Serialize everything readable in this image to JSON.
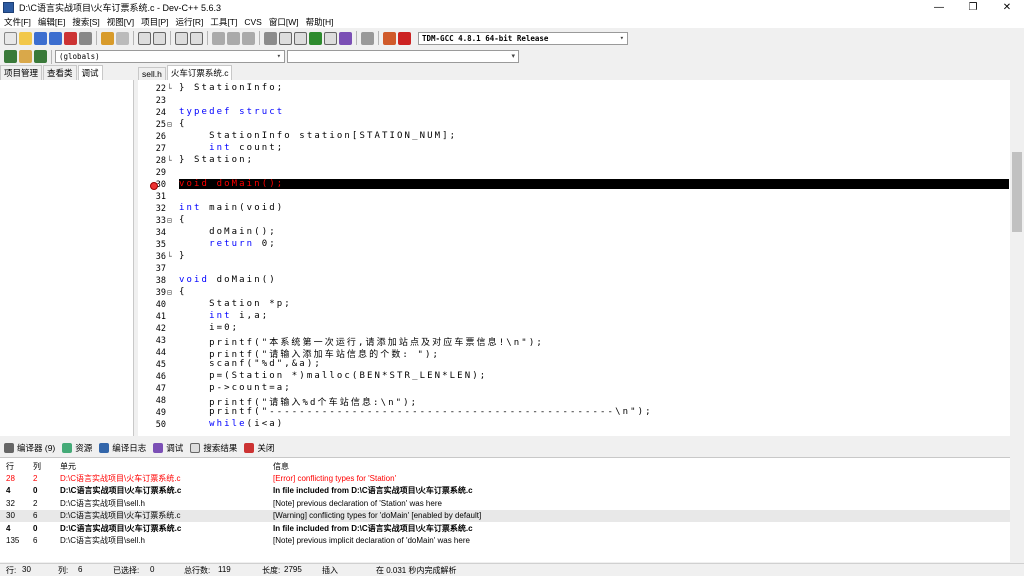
{
  "window": {
    "title": "D:\\C语言实战项目\\火车订票系统.c - Dev-C++ 5.6.3"
  },
  "menu": [
    "文件[F]",
    "编辑[E]",
    "搜索[S]",
    "视图[V]",
    "项目[P]",
    "运行[R]",
    "工具[T]",
    "CVS",
    "窗口[W]",
    "帮助[H]"
  ],
  "toolbar": {
    "compiler_select": "TDM-GCC 4.8.1 64-bit Release",
    "scope_select": "(globals)",
    "symbol_select": ""
  },
  "left_tabs": [
    "项目管理",
    "查看类",
    "调试"
  ],
  "editor_tabs": [
    "sell.h",
    "火车订票系统.c"
  ],
  "code_lines": [
    {
      "n": "22",
      "fold": "└",
      "t": "} StationInfo;"
    },
    {
      "n": "23",
      "fold": "",
      "t": ""
    },
    {
      "n": "24",
      "fold": "",
      "t": "typedef struct",
      "kw": true
    },
    {
      "n": "25",
      "fold": "⊟",
      "t": "{"
    },
    {
      "n": "26",
      "fold": "",
      "t": "    StationInfo station[STATION_NUM];"
    },
    {
      "n": "27",
      "fold": "",
      "t": "    int count;",
      "kwpart": "int"
    },
    {
      "n": "28",
      "fold": "└",
      "t": "} Station;"
    },
    {
      "n": "29",
      "fold": "",
      "t": ""
    },
    {
      "n": "30",
      "fold": "",
      "t": "void doMain();",
      "error": true
    },
    {
      "n": "31",
      "fold": "",
      "t": ""
    },
    {
      "n": "32",
      "fold": "",
      "t": "int main(void)",
      "kwpart": "int"
    },
    {
      "n": "33",
      "fold": "⊟",
      "t": "{"
    },
    {
      "n": "34",
      "fold": "",
      "t": "    doMain();"
    },
    {
      "n": "35",
      "fold": "",
      "t": "    return 0;",
      "kwpart": "return"
    },
    {
      "n": "36",
      "fold": "└",
      "t": "}"
    },
    {
      "n": "37",
      "fold": "",
      "t": ""
    },
    {
      "n": "38",
      "fold": "",
      "t": "void doMain()",
      "kwpart": "void"
    },
    {
      "n": "39",
      "fold": "⊟",
      "t": "{"
    },
    {
      "n": "40",
      "fold": "",
      "t": "    Station *p;"
    },
    {
      "n": "41",
      "fold": "",
      "t": "    int i,a;",
      "kwpart": "int"
    },
    {
      "n": "42",
      "fold": "",
      "t": "    i=0;"
    },
    {
      "n": "43",
      "fold": "",
      "t": "    printf(\"本系统第一次运行,请添加站点及对应车票信息!\\n\");"
    },
    {
      "n": "44",
      "fold": "",
      "t": "    printf(\"请输入添加车站信息的个数: \");"
    },
    {
      "n": "45",
      "fold": "",
      "t": "    scanf(\"%d\",&a);"
    },
    {
      "n": "46",
      "fold": "",
      "t": "    p=(Station *)malloc(BEN*STR_LEN*LEN);"
    },
    {
      "n": "47",
      "fold": "",
      "t": "    p->count=a;"
    },
    {
      "n": "48",
      "fold": "",
      "t": "    printf(\"请输入%d个车站信息:\\n\");"
    },
    {
      "n": "49",
      "fold": "",
      "t": "    printf(\"----------------------------------------------\\n\");"
    },
    {
      "n": "50",
      "fold": "",
      "t": "    while(i<a)",
      "kwpart": "while"
    }
  ],
  "bottom_tabs": [
    "编译器 (9)",
    "资源",
    "编译日志",
    "调试",
    "搜索结果",
    "关闭"
  ],
  "messages": {
    "headers": [
      "行",
      "列",
      "单元",
      "信息"
    ],
    "rows": [
      {
        "line": "28",
        "col": "2",
        "unit": "D:\\C语言实战项目\\火车订票系统.c",
        "msg": "[Error] conflicting types for 'Station'",
        "style": "err"
      },
      {
        "line": "4",
        "col": "0",
        "unit": "D:\\C语言实战项目\\火车订票系统.c",
        "msg": "In file included from D:\\C语言实战项目\\火车订票系统.c",
        "style": "bold"
      },
      {
        "line": "32",
        "col": "2",
        "unit": "D:\\C语言实战项目\\sell.h",
        "msg": "[Note] previous declaration of 'Station' was here",
        "style": ""
      },
      {
        "line": "30",
        "col": "6",
        "unit": "D:\\C语言实战项目\\火车订票系统.c",
        "msg": "[Warning] conflicting types for 'doMain' [enabled by default]",
        "style": "shade"
      },
      {
        "line": "4",
        "col": "0",
        "unit": "D:\\C语言实战项目\\火车订票系统.c",
        "msg": "In file included from D:\\C语言实战项目\\火车订票系统.c",
        "style": "bold"
      },
      {
        "line": "135",
        "col": "6",
        "unit": "D:\\C语言实战项目\\sell.h",
        "msg": "[Note] previous implicit declaration of 'doMain' was here",
        "style": ""
      }
    ]
  },
  "status": {
    "row_label": "行:",
    "row": "30",
    "col_label": "列:",
    "col": "6",
    "sel_label": "已选择:",
    "sel": "0",
    "lines_label": "总行数:",
    "lines": "119",
    "len_label": "长度:",
    "len": "2795",
    "mode": "插入",
    "parse": "在 0.031 秒内完成解析"
  },
  "colors": {
    "keyword": "#0000ff",
    "error_line_bg": "#000000",
    "error_text": "#ff0000"
  }
}
